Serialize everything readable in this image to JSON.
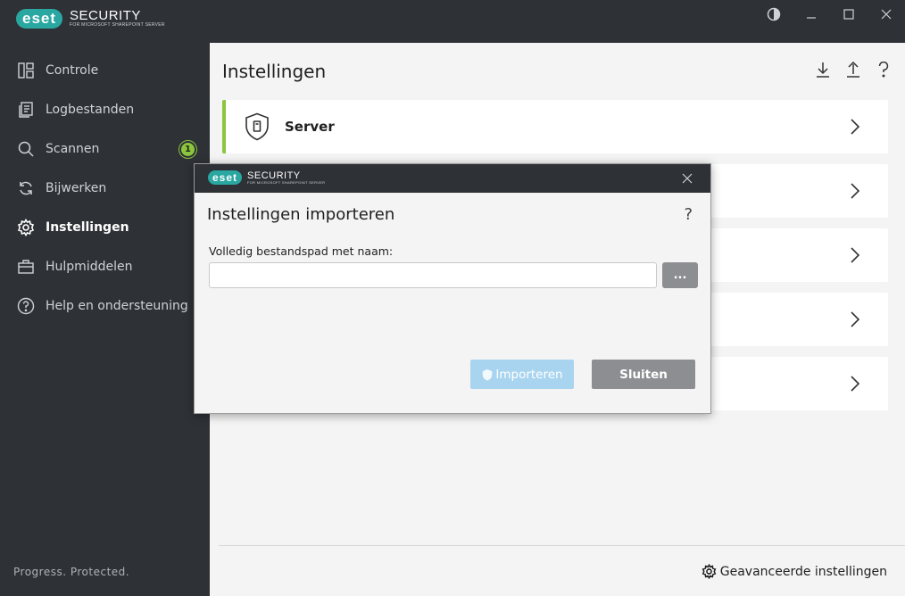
{
  "app": {
    "brand_badge": "eset",
    "brand_name": "SECURITY",
    "brand_sub": "FOR MICROSOFT SHAREPOINT SERVER",
    "window_controls": [
      "contrast-icon",
      "minimize-icon",
      "maximize-icon",
      "close-icon"
    ]
  },
  "sidebar": {
    "items": [
      {
        "label": "Controle",
        "icon": "dashboard-icon"
      },
      {
        "label": "Logbestanden",
        "icon": "log-files-icon"
      },
      {
        "label": "Scannen",
        "icon": "search-icon",
        "badge": "1"
      },
      {
        "label": "Bijwerken",
        "icon": "refresh-icon"
      },
      {
        "label": "Instellingen",
        "icon": "gear-icon",
        "active": true
      },
      {
        "label": "Hulpmiddelen",
        "icon": "toolbox-icon"
      },
      {
        "label": "Help en ondersteuning",
        "icon": "help-icon"
      }
    ],
    "tagline": "Progress. Protected."
  },
  "main": {
    "title": "Instellingen",
    "actions": [
      "import-icon",
      "export-icon",
      "help-icon"
    ],
    "cards": [
      {
        "label": "Server",
        "icon": "server-shield-icon"
      },
      {
        "label": ""
      },
      {
        "label": ""
      },
      {
        "label": ""
      },
      {
        "label": ""
      }
    ],
    "advanced_label": "Geavanceerde instellingen"
  },
  "dialog": {
    "title": "Instellingen importeren",
    "help": "?",
    "field_label": "Volledig bestandspad met naam:",
    "field_value": "",
    "browse_label": "...",
    "import_label": "Importeren",
    "close_label": "Sluiten"
  },
  "colors": {
    "sidebar_bg": "#2e3136",
    "accent_green": "#8cc63f",
    "brand_teal": "#2aa7a1",
    "import_disabled": "#a9d4ef",
    "button_gray": "#8c8e91"
  }
}
